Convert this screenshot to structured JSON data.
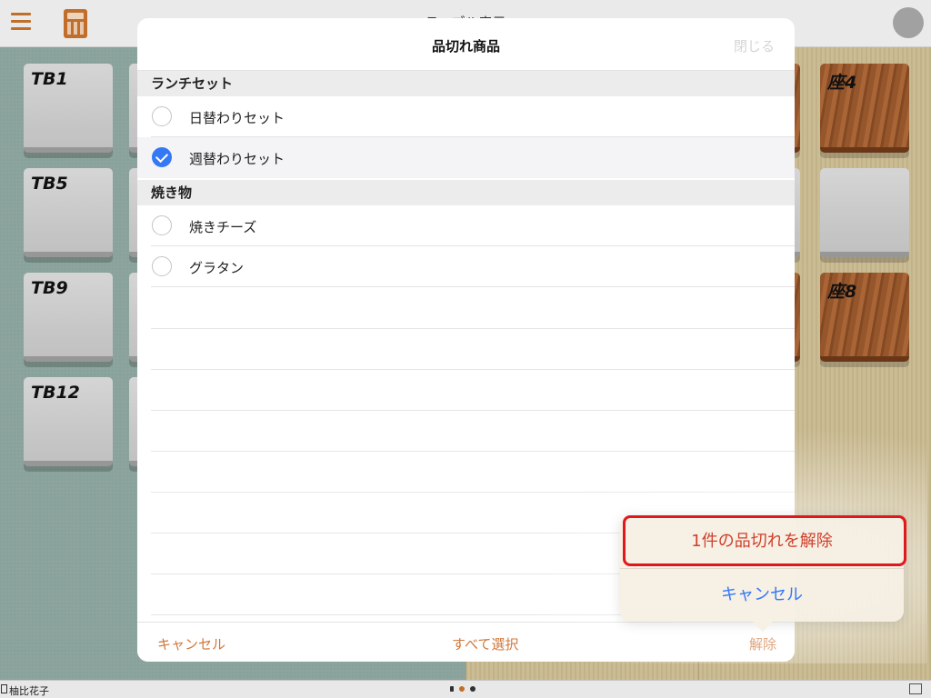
{
  "topbar": {
    "title": "テーブル表示"
  },
  "tables_left": [
    {
      "label": "TB1"
    },
    {
      "label": "TB5"
    },
    {
      "label": "TB9"
    },
    {
      "label": "TB12"
    }
  ],
  "tables_right": [
    {
      "label": "座4"
    },
    {
      "label": ""
    },
    {
      "label": "座8"
    }
  ],
  "modal": {
    "title": "品切れ商品",
    "close_label": "閉じる",
    "sections": [
      {
        "header": "ランチセット",
        "items": [
          {
            "label": "日替わりセット",
            "checked": false
          },
          {
            "label": "週替わりセット",
            "checked": true
          }
        ]
      },
      {
        "header": "焼き物",
        "items": [
          {
            "label": "焼きチーズ",
            "checked": false
          },
          {
            "label": "グラタン",
            "checked": false
          }
        ]
      }
    ],
    "footer": {
      "cancel_label": "キャンセル",
      "select_all_label": "すべて選択",
      "release_label": "解除"
    }
  },
  "popover": {
    "confirm_label": "1件の品切れを解除",
    "cancel_label": "キャンセル"
  },
  "statusbar": {
    "user": "柚比花子"
  },
  "colors": {
    "accent": "#d0773a",
    "destructive": "#d0402c",
    "link": "#3478f6",
    "highlight": "#e0181c"
  }
}
